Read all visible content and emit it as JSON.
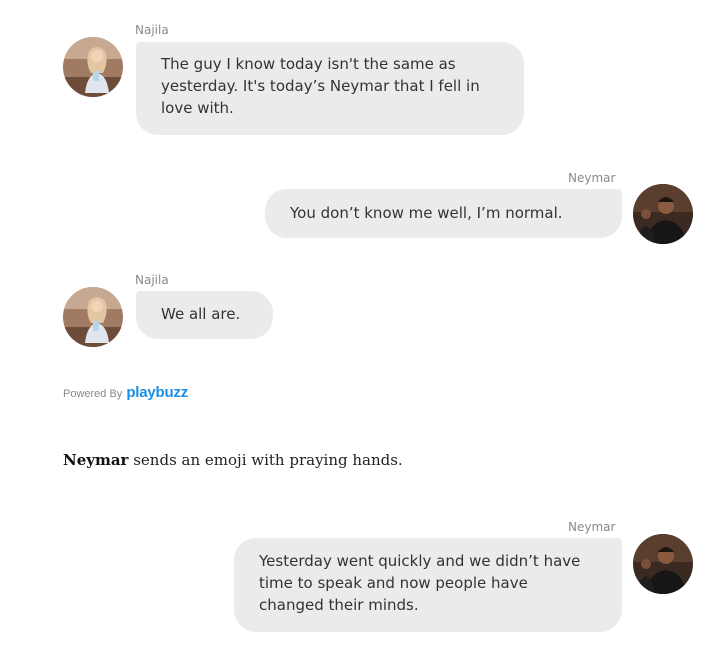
{
  "colors": {
    "bubble_bg": "#ebebeb",
    "bubble_text": "#333333",
    "name_text": "#8a8a8a",
    "brand_blue": "#1a8fe6"
  },
  "chat1": {
    "messages": [
      {
        "sender": "Najila",
        "side": "left",
        "avatar_icon": "najila-avatar",
        "text": "The guy I know today isn't the same as yesterday. It's today’s Neymar that I fell in love with."
      },
      {
        "sender": "Neymar",
        "side": "right",
        "avatar_icon": "neymar-avatar",
        "text": "You don’t know me well, I’m normal."
      },
      {
        "sender": "Najila",
        "side": "left",
        "avatar_icon": "najila-avatar",
        "text": "We all are."
      }
    ],
    "powered_by": {
      "label": "Powered By",
      "brand": "playbuzz"
    }
  },
  "article": {
    "subject": "Neymar",
    "rest": " sends an emoji with praying hands."
  },
  "chat2": {
    "messages": [
      {
        "sender": "Neymar",
        "side": "right",
        "avatar_icon": "neymar-avatar",
        "text": "Yesterday went quickly and we didn’t have time to speak and now people have changed their minds."
      }
    ]
  }
}
